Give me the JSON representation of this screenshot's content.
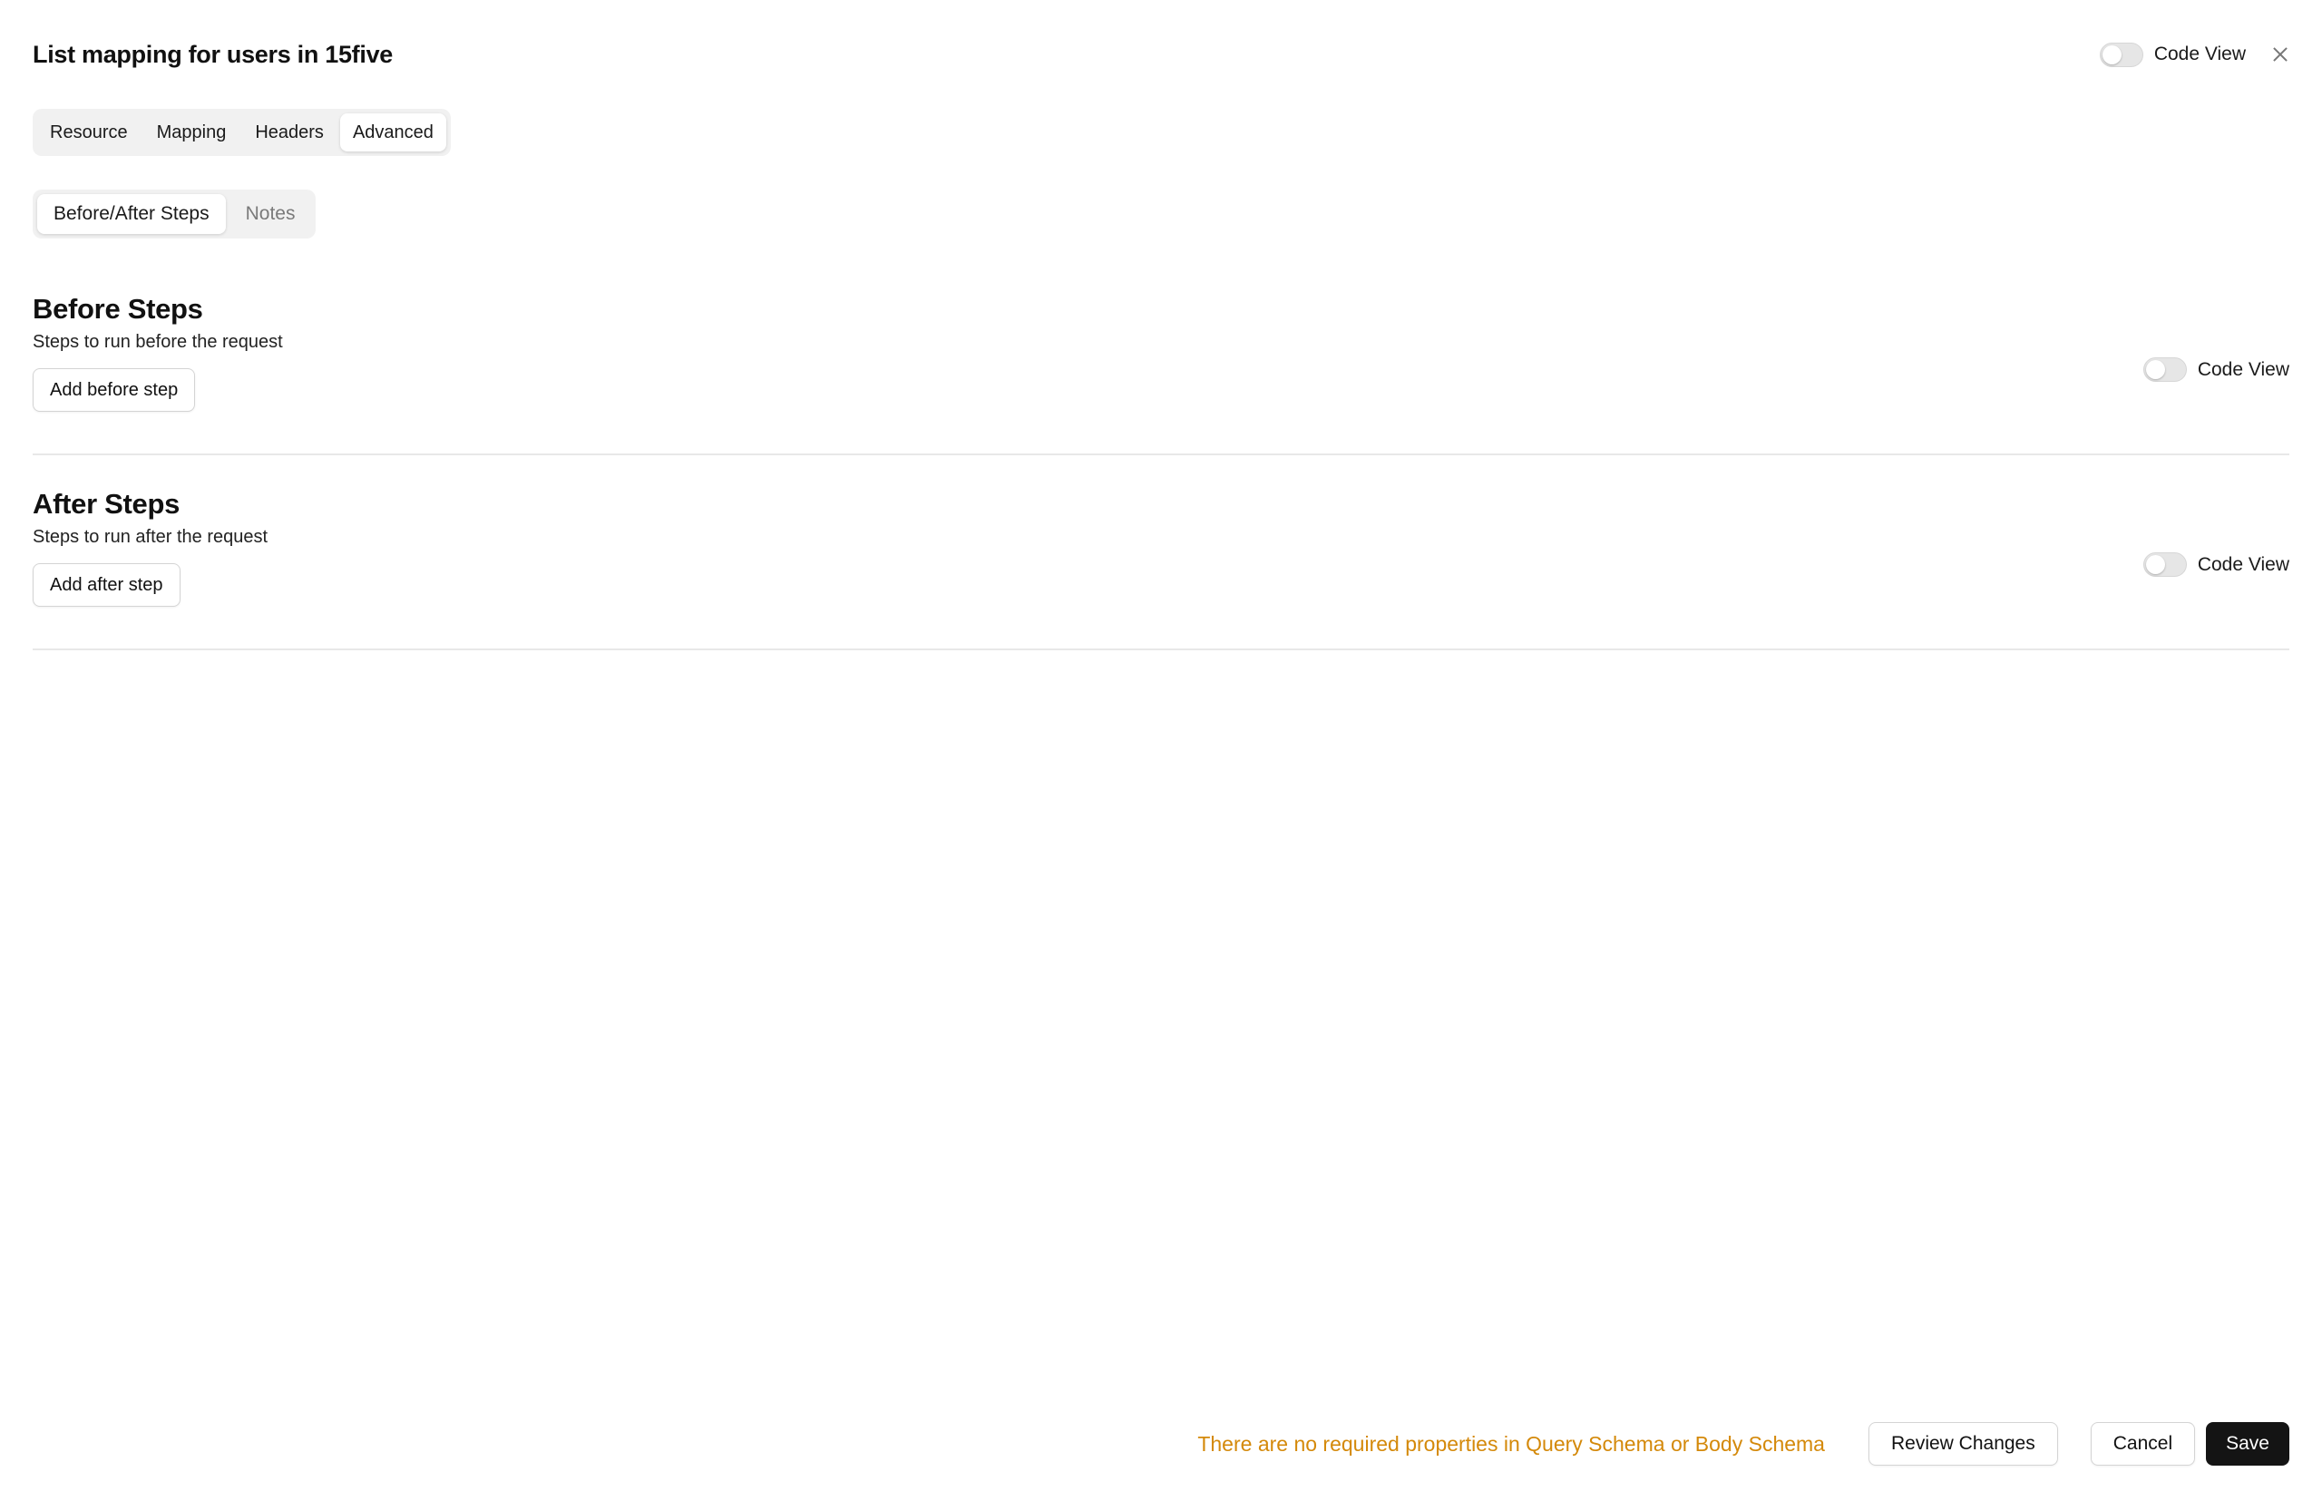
{
  "dialog": {
    "title": "List mapping for users in 15five",
    "code_view_label": "Code View",
    "close_icon": "close-icon"
  },
  "tabs": [
    {
      "label": "Resource",
      "active": false
    },
    {
      "label": "Mapping",
      "active": false
    },
    {
      "label": "Headers",
      "active": false
    },
    {
      "label": "Advanced",
      "active": true
    }
  ],
  "subtabs": [
    {
      "label": "Before/After Steps",
      "active": true
    },
    {
      "label": "Notes",
      "active": false
    }
  ],
  "before_steps": {
    "title": "Before Steps",
    "description": "Steps to run before the request",
    "button_label": "Add before step",
    "code_view_label": "Code View"
  },
  "after_steps": {
    "title": "After Steps",
    "description": "Steps to run after the request",
    "button_label": "Add after step",
    "code_view_label": "Code View"
  },
  "footer": {
    "note": "There are no required properties in Query Schema or Body Schema",
    "note_color": "#d4890a",
    "review_label": "Review Changes",
    "cancel_label": "Cancel",
    "save_label": "Save"
  }
}
